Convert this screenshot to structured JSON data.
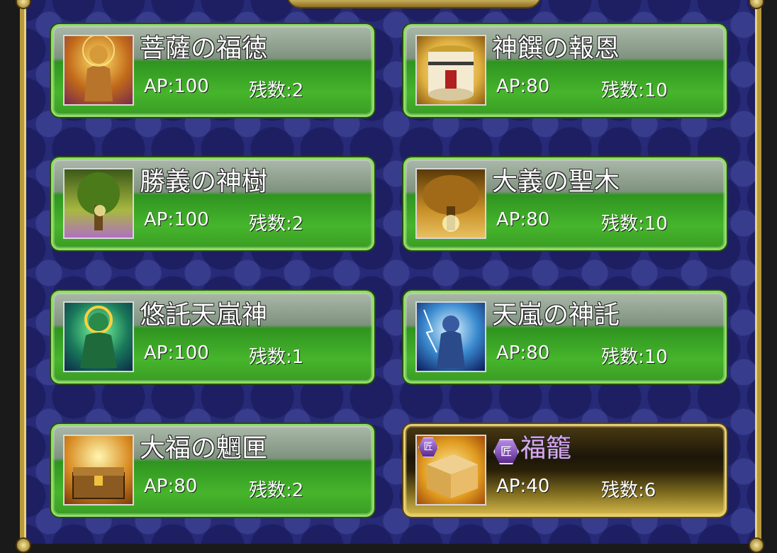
{
  "items": [
    {
      "name": "菩薩の福徳",
      "ap": "AP:100",
      "remaining": "残数:2",
      "icon": "buddha-statue-icon",
      "gold": false
    },
    {
      "name": "神饌の報恩",
      "ap": "AP:80",
      "remaining": "残数:10",
      "icon": "sake-barrel-icon",
      "gold": false
    },
    {
      "name": "勝義の神樹",
      "ap": "AP:100",
      "remaining": "残数:2",
      "icon": "sacred-tree-icon",
      "gold": false
    },
    {
      "name": "大義の聖木",
      "ap": "AP:80",
      "remaining": "残数:10",
      "icon": "holy-tree-icon",
      "gold": false
    },
    {
      "name": "悠託天嵐神",
      "ap": "AP:100",
      "remaining": "残数:1",
      "icon": "storm-god-icon",
      "gold": false
    },
    {
      "name": "天嵐の神託",
      "ap": "AP:80",
      "remaining": "残数:10",
      "icon": "storm-oracle-icon",
      "gold": false
    },
    {
      "name": "大福の魍匣",
      "ap": "AP:80",
      "remaining": "残数:2",
      "icon": "treasure-chest-icon",
      "gold": false
    },
    {
      "name": "福籠",
      "ap": "AP:40",
      "remaining": "残数:6",
      "icon": "lucky-box-icon",
      "gold": true,
      "badge": "匠"
    }
  ]
}
